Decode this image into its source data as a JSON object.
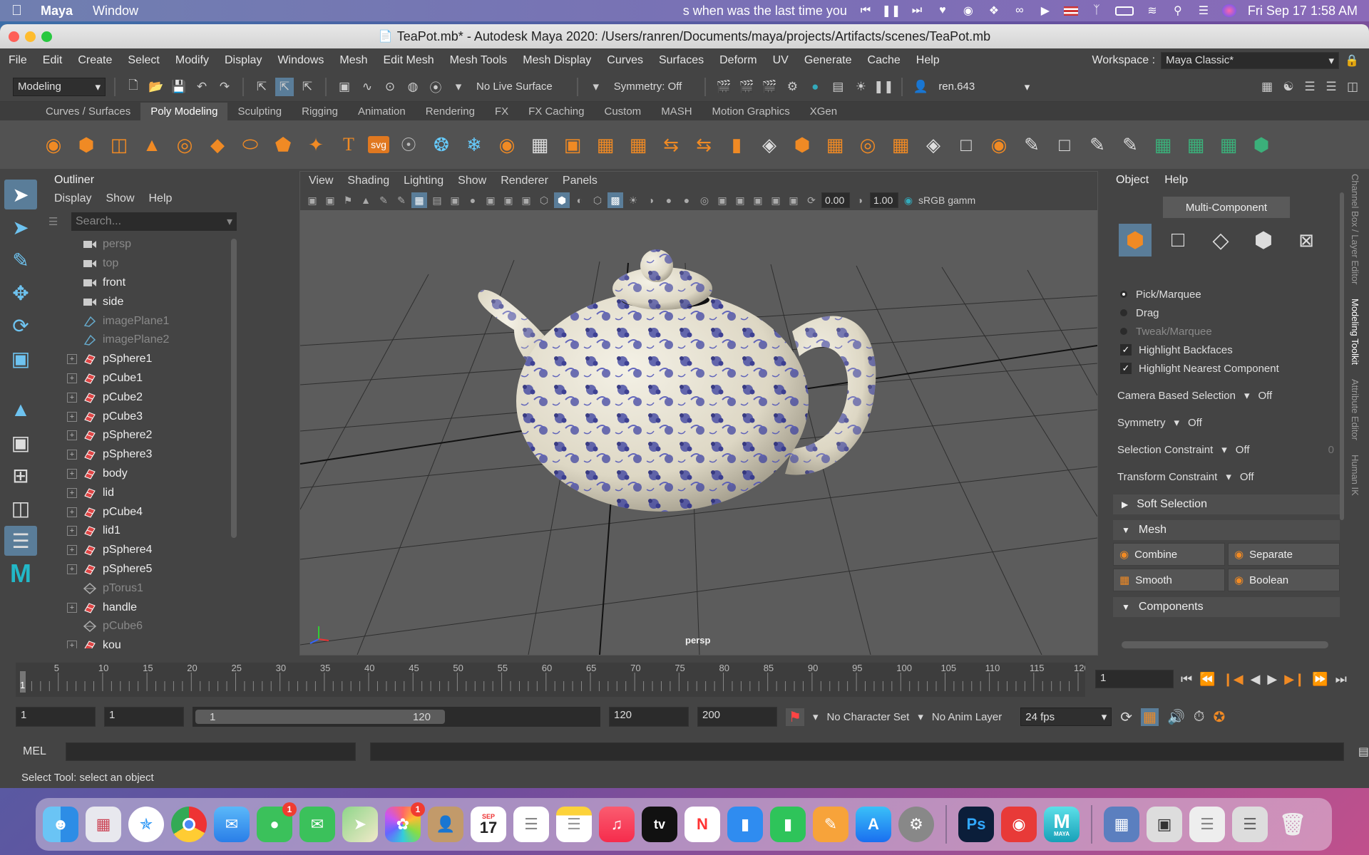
{
  "mac": {
    "app_name": "Maya",
    "menus": [
      "Window"
    ],
    "now_playing": "s when was the last time you",
    "datetime": "Fri Sep 17  1:58 AM"
  },
  "window": {
    "title": "TeaPot.mb* - Autodesk Maya 2020: /Users/ranren/Documents/maya/projects/Artifacts/scenes/TeaPot.mb"
  },
  "menubar": {
    "items": [
      "File",
      "Edit",
      "Create",
      "Select",
      "Modify",
      "Display",
      "Windows",
      "Mesh",
      "Edit Mesh",
      "Mesh Tools",
      "Mesh Display",
      "Curves",
      "Surfaces",
      "Deform",
      "UV",
      "Generate",
      "Cache",
      "Help"
    ],
    "workspace_label": "Workspace :",
    "workspace_value": "Maya Classic*"
  },
  "statusline": {
    "mode": "Modeling",
    "live_surface": "No Live Surface",
    "symmetry": "Symmetry: Off",
    "user": "ren.643"
  },
  "shelf": {
    "tabs": [
      "Curves / Surfaces",
      "Poly Modeling",
      "Sculpting",
      "Rigging",
      "Animation",
      "Rendering",
      "FX",
      "FX Caching",
      "Custom",
      "MASH",
      "Motion Graphics",
      "XGen"
    ],
    "active_tab": "Poly Modeling"
  },
  "outliner": {
    "title": "Outliner",
    "menus": [
      "Display",
      "Show",
      "Help"
    ],
    "search_placeholder": "Search...",
    "items": [
      {
        "name": "persp",
        "dim": true,
        "expand": false,
        "icon": "camera"
      },
      {
        "name": "top",
        "dim": true,
        "expand": false,
        "icon": "camera"
      },
      {
        "name": "front",
        "dim": false,
        "expand": false,
        "icon": "camera"
      },
      {
        "name": "side",
        "dim": false,
        "expand": false,
        "icon": "camera"
      },
      {
        "name": "imagePlane1",
        "dim": true,
        "expand": false,
        "icon": "imageplane"
      },
      {
        "name": "imagePlane2",
        "dim": true,
        "expand": false,
        "icon": "imageplane"
      },
      {
        "name": "pSphere1",
        "dim": false,
        "expand": true,
        "icon": "mesh"
      },
      {
        "name": "pCube1",
        "dim": false,
        "expand": true,
        "icon": "mesh"
      },
      {
        "name": "pCube2",
        "dim": false,
        "expand": true,
        "icon": "mesh"
      },
      {
        "name": "pCube3",
        "dim": false,
        "expand": true,
        "icon": "mesh"
      },
      {
        "name": "pSphere2",
        "dim": false,
        "expand": true,
        "icon": "mesh"
      },
      {
        "name": "pSphere3",
        "dim": false,
        "expand": true,
        "icon": "mesh"
      },
      {
        "name": "body",
        "dim": false,
        "expand": true,
        "icon": "mesh"
      },
      {
        "name": "lid",
        "dim": false,
        "expand": true,
        "icon": "mesh"
      },
      {
        "name": "pCube4",
        "dim": false,
        "expand": true,
        "icon": "mesh"
      },
      {
        "name": "lid1",
        "dim": false,
        "expand": true,
        "icon": "mesh"
      },
      {
        "name": "pSphere4",
        "dim": false,
        "expand": true,
        "icon": "mesh"
      },
      {
        "name": "pSphere5",
        "dim": false,
        "expand": true,
        "icon": "mesh"
      },
      {
        "name": "pTorus1",
        "dim": true,
        "expand": false,
        "icon": "group"
      },
      {
        "name": "handle",
        "dim": false,
        "expand": true,
        "icon": "mesh"
      },
      {
        "name": "pCube6",
        "dim": true,
        "expand": false,
        "icon": "group"
      },
      {
        "name": "kou",
        "dim": false,
        "expand": true,
        "icon": "mesh"
      }
    ]
  },
  "viewport": {
    "menus": [
      "View",
      "Shading",
      "Lighting",
      "Show",
      "Renderer",
      "Panels"
    ],
    "exposure": "0.00",
    "gamma": "1.00",
    "color_space": "sRGB gamm",
    "camera_label": "persp"
  },
  "modeling_toolkit": {
    "menus": [
      "Object",
      "Help"
    ],
    "multi_component": "Multi-Component",
    "pick_marquee": "Pick/Marquee",
    "drag": "Drag",
    "tweak_marquee": "Tweak/Marquee",
    "highlight_backfaces": "Highlight Backfaces",
    "highlight_nearest": "Highlight Nearest Component",
    "camera_based_selection": "Camera Based Selection",
    "camera_based_value": "Off",
    "symmetry_label": "Symmetry",
    "symmetry_value": "Off",
    "selection_constraint": "Selection Constraint",
    "selection_constraint_value": "Off",
    "selection_constraint_num": "0",
    "transform_constraint": "Transform Constraint",
    "transform_constraint_value": "Off",
    "soft_selection": "Soft Selection",
    "mesh_section": "Mesh",
    "combine": "Combine",
    "separate": "Separate",
    "smooth": "Smooth",
    "boolean": "Boolean",
    "components_section": "Components"
  },
  "side_tabs": [
    "Channel Box / Layer Editor",
    "Modeling Toolkit",
    "Attribute Editor",
    "Human IK"
  ],
  "timeline": {
    "ticks": [
      "5",
      "10",
      "15",
      "20",
      "25",
      "30",
      "35",
      "40",
      "45",
      "50",
      "55",
      "60",
      "65",
      "70",
      "75",
      "80",
      "85",
      "90",
      "95",
      "100",
      "105",
      "110",
      "115",
      "120"
    ],
    "start_label": "1",
    "current_frame": "1"
  },
  "range": {
    "start": "1",
    "playback_start": "1",
    "slider_start": "1",
    "slider_end": "120",
    "playback_end": "120",
    "end": "200",
    "character_set": "No Character Set",
    "anim_layer": "No Anim Layer",
    "fps": "24 fps"
  },
  "mel": {
    "label": "MEL"
  },
  "helpline": {
    "text": "Select Tool: select an object"
  },
  "dock": {
    "calendar_month": "SEP",
    "calendar_day": "17",
    "facetime_badge": "1",
    "photos_badge": "1",
    "tv_label": "tv",
    "ps_label": "Ps",
    "maya_label": "MAYA"
  }
}
